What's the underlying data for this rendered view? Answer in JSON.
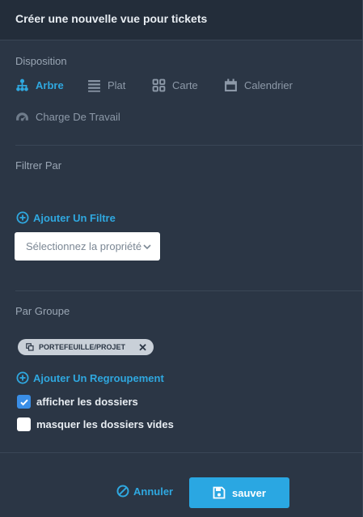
{
  "header": {
    "title": "Créer une nouvelle vue pour tickets"
  },
  "layout_section": {
    "title": "Disposition",
    "options": [
      {
        "label": "Arbre",
        "icon": "tree-icon",
        "selected": true
      },
      {
        "label": "Plat",
        "icon": "list-icon",
        "selected": false
      },
      {
        "label": "Carte",
        "icon": "grid-icon",
        "selected": false
      },
      {
        "label": "Calendrier",
        "icon": "calendar-icon",
        "selected": false
      },
      {
        "label": "Charge De Travail",
        "icon": "gauge-icon",
        "selected": false
      }
    ]
  },
  "filter_section": {
    "title": "Filtrer Par",
    "add_filter_label": "Ajouter Un Filtre",
    "property_select": "Sélectionnez la propriété"
  },
  "group_section": {
    "title": "Par Groupe",
    "chip_label": "PORTEFEUILLE/PROJET",
    "add_group_label": "Ajouter Un Regroupement",
    "show_folders_label": "afficher les dossiers",
    "show_folders_checked": true,
    "hide_empty_label": "masquer les dossiers vides",
    "hide_empty_checked": false
  },
  "footer": {
    "cancel_label": "Annuler",
    "save_label": "sauver"
  },
  "colors": {
    "accent": "#2fa8e0",
    "background": "#2b3645",
    "header": "#232d3a",
    "checkbox": "#3a8ee6"
  }
}
